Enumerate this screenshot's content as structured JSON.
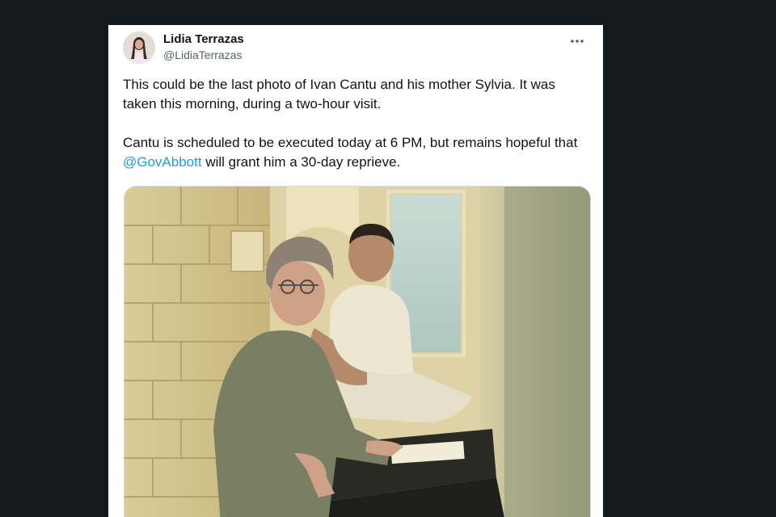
{
  "tweet": {
    "author": {
      "display_name": "Lidia Terrazas",
      "handle": "@LidiaTerrazas"
    },
    "paragraph_1": "This could be the last photo of Ivan Cantu and his mother Sylvia. It was taken this morning, during a two-hour visit.",
    "paragraph_2_before": "Cantu is scheduled to be executed today at 6 PM, but remains hopeful that ",
    "mention": "@GovAbbott",
    "paragraph_2_after": " will grant him a 30-day reprieve.",
    "more_icon": "more-horizontal-icon"
  },
  "colors": {
    "page_background": "#14191f",
    "card_background": "#ffffff",
    "text_primary": "#0f1419",
    "text_secondary": "#536471",
    "link": "#1d9bf0"
  }
}
